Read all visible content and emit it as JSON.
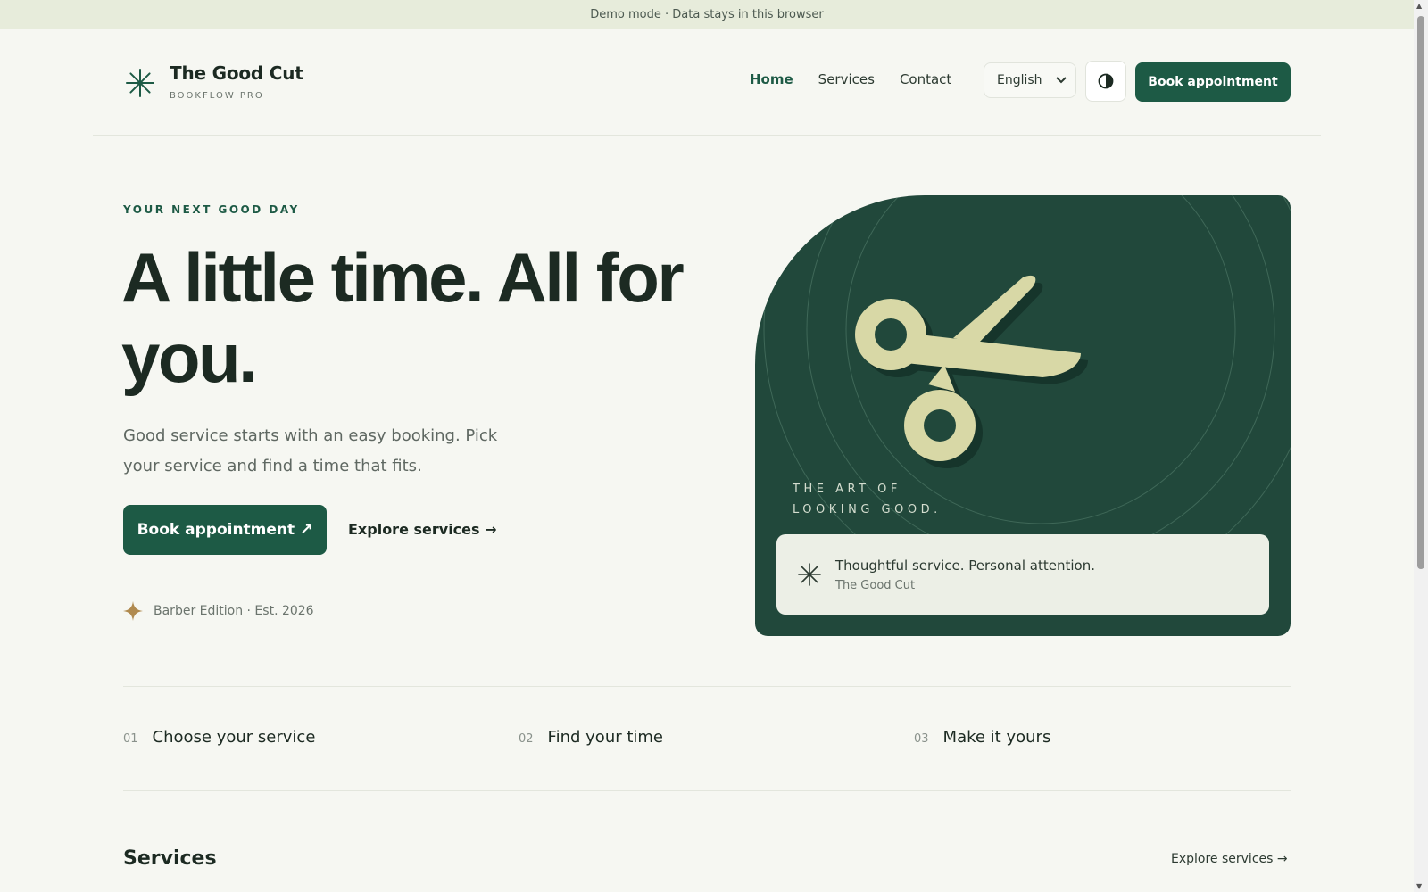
{
  "banner": {
    "text": "Demo mode · Data stays in this browser"
  },
  "header": {
    "brand_name": "The Good Cut",
    "brand_sub": "BOOKFLOW PRO",
    "nav": [
      {
        "label": "Home",
        "active": true
      },
      {
        "label": "Services",
        "active": false
      },
      {
        "label": "Contact",
        "active": false
      }
    ],
    "language": "English",
    "book_label": "Book appointment"
  },
  "hero": {
    "eyebrow": "YOUR NEXT GOOD DAY",
    "title": "A little time. All for you.",
    "text": "Good service starts with an easy booking. Pick your service and find a time that fits.",
    "primary_cta": "Book appointment",
    "primary_cta_icon": "↗",
    "secondary_cta": "Explore services →",
    "edition": "Barber Edition · Est. 2026"
  },
  "hero_card": {
    "tagline_line1": "THE ART OF",
    "tagline_line2": "LOOKING GOOD.",
    "quote_main": "Thoughtful service. Personal attention.",
    "quote_sub": "The Good Cut"
  },
  "steps": [
    {
      "num": "01",
      "label": "Choose your service"
    },
    {
      "num": "02",
      "label": "Find your time"
    },
    {
      "num": "03",
      "label": "Make it yours"
    }
  ],
  "services": {
    "title": "Services",
    "link": "Explore services →"
  },
  "colors": {
    "accent": "#1d5a45",
    "card_bg": "#21483b",
    "scissors": "#d8d8a6",
    "gold": "#b08a4f",
    "page_bg": "#f6f7f2"
  },
  "icons": {
    "brand": "asterisk-icon",
    "theme": "contrast-icon",
    "edition": "sparkle-icon",
    "card": "scissors-icon",
    "quote": "asterisk-icon"
  }
}
